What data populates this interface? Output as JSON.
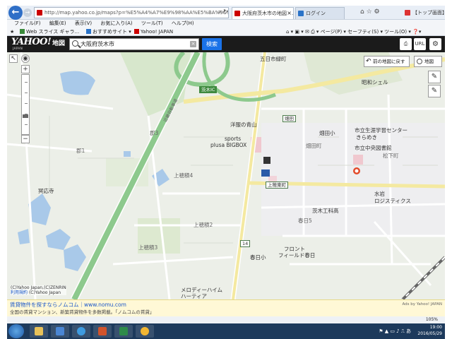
{
  "browser": {
    "url": "http://map.yahoo.co.jp/maps?p=%E5%A4%A7%E9%98%AA%E5%BA%9C%E8%8C%A8%...",
    "active_tab": "大阪府茨木市の地図 - ...",
    "tab2": "ログイン",
    "tab3": "【トップ画面】",
    "menu": [
      "ファイル(F)",
      "編集(E)",
      "表示(V)",
      "お気に入り(A)",
      "ツール(T)",
      "ヘルプ(H)"
    ],
    "favorites": {
      "web_slice": "Web スライス ギャラ...",
      "recommended": "おすすめサイト ▾",
      "yahoo": "Yahoo! JAPAN"
    },
    "command_tools": "ページ(P) ▾  セーフティ(S) ▾  ツール(O) ▾"
  },
  "yahoo_header": {
    "logo": "YAHOO!",
    "logo_sub": "JAPAN",
    "section": "地図",
    "search_value": "大阪府茨木市",
    "search_button": "検索",
    "print_icon": "print-icon",
    "url_label": "URL",
    "settings_icon": "gear-icon"
  },
  "map": {
    "back_button": "前の地図に戻す",
    "layer_button": "地図",
    "labels": {
      "gojo": "五日市緑町",
      "ibaraki_ic": "茨木IC",
      "showa_shell": "昭和シェル",
      "yofuku": "洋服の青山",
      "sports": "sports",
      "plusa": "plusa BIGBOX",
      "hatada_sign": "畑田",
      "hatada_school": "畑田小",
      "hatada_cho": "畑田町",
      "life_center": "市立生涯学習センター",
      "kirameki": "きらめき",
      "library": "市立中央図書館",
      "matsushita": "松下町",
      "kamihozumi4": "上穂積4",
      "kamihozumi_east": "上穂東町",
      "mizuiwa": "水岩",
      "logistics": "ロジスティクス",
      "ibaraki_tech": "茨木工科高",
      "kasuga3": "春日5",
      "kamihozumi2": "上穂積2",
      "kamihozumi3": "上穂積3",
      "kasuga_school": "春日小",
      "frontfield": "フロント",
      "frontfield2": "フィールド春日",
      "melody": "メロディーハイム",
      "harty": "ハーティア",
      "kori3": "郡3",
      "kori1": "郡1",
      "meiohji": "冥応寺",
      "route14": "14",
      "expressway": "近畿自動車道"
    },
    "copyright": "(C)Yahoo Japan,(C)ZENRIN",
    "terms_link": "利用規約",
    "copyright2": "(C)Yahoo Japan"
  },
  "ad": {
    "title": "賃貸物件を探すならノムコム｜www.nomu.com",
    "description": "全国の賃貸マンション、新築賃貸物件を多数掲載。「ノムコムの賃貸」",
    "tag": "Ads by Yahoo! JAPAN"
  },
  "status": {
    "zoom": "105%"
  },
  "taskbar": {
    "time": "19:00",
    "date": "2016/05/29"
  }
}
